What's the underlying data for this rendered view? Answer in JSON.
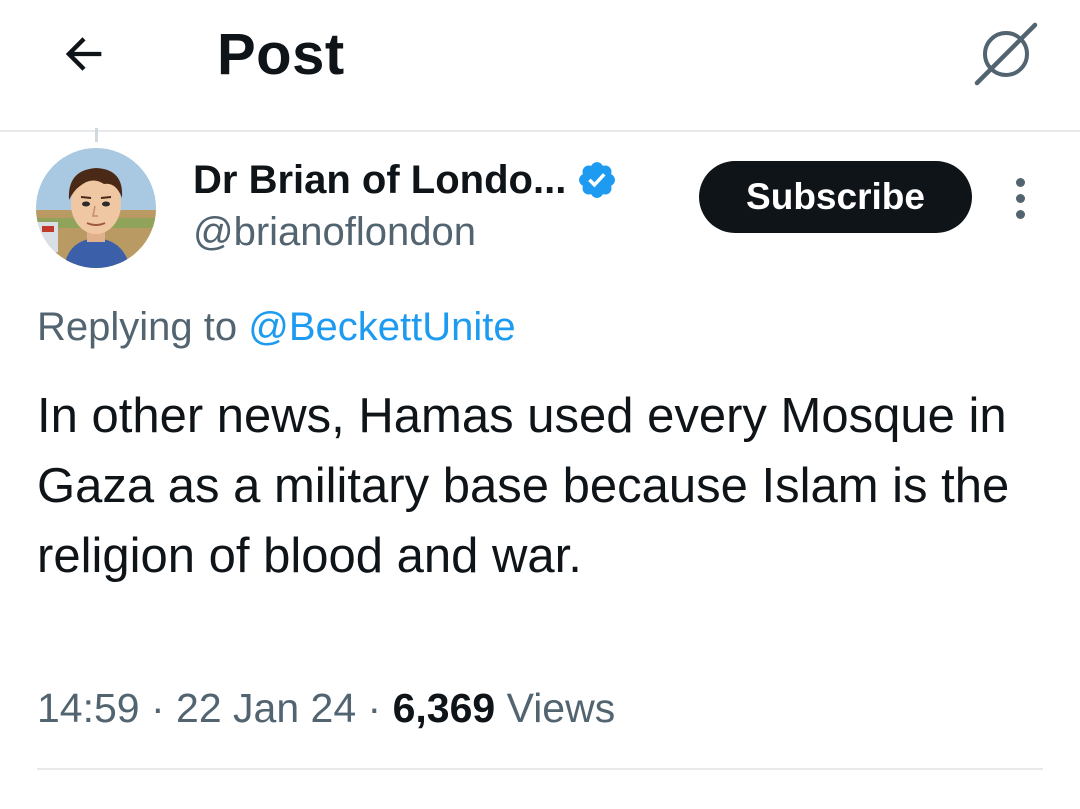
{
  "header": {
    "title": "Post",
    "back_icon": "arrow-left-icon",
    "grok_icon": "grok-icon"
  },
  "author": {
    "display_name": "Dr Brian of Londo...",
    "handle": "@brianoflondon",
    "verified": true,
    "verified_color": "#1d9bf0"
  },
  "actions": {
    "subscribe_label": "Subscribe",
    "more_icon": "more-vertical-icon"
  },
  "reply": {
    "prefix": "Replying to ",
    "mention": "@BeckettUnite"
  },
  "post": {
    "text": "In other news, Hamas used every Mosque in Gaza as a military base because Islam is the religion of blood and war.",
    "time": "14:59",
    "sep1": " · ",
    "date": "22 Jan 24",
    "sep2": " · ",
    "views_count": "6,369",
    "views_label": " Views"
  },
  "colors": {
    "text_primary": "#0f1419",
    "text_secondary": "#536471",
    "accent": "#1d9bf0",
    "border": "#e7e9ea"
  }
}
